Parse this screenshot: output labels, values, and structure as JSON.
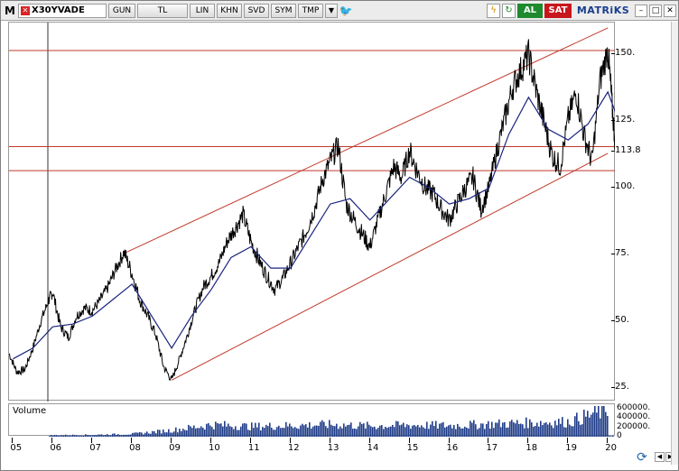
{
  "toolbar": {
    "menu_label": "M",
    "symbol": "X30YVADE",
    "buttons": [
      "GUN",
      "TL",
      "LIN",
      "KHN",
      "SVD",
      "SYM",
      "TMP"
    ],
    "buy_label": "AL",
    "sell_label": "SAT",
    "brand": "MATRiKS"
  },
  "price_axis": {
    "labels": [
      {
        "value": 150,
        "text": "150."
      },
      {
        "value": 125,
        "text": "125."
      },
      {
        "value": 113.8,
        "text": "113.8"
      },
      {
        "value": 100,
        "text": "100."
      },
      {
        "value": 75,
        "text": "75."
      },
      {
        "value": 50,
        "text": "50."
      },
      {
        "value": 25,
        "text": "25."
      }
    ]
  },
  "volume": {
    "title": "Volume",
    "labels": [
      {
        "value": 600000,
        "text": "600000."
      },
      {
        "value": 400000,
        "text": "400000."
      },
      {
        "value": 200000,
        "text": "200000."
      },
      {
        "value": 0,
        "text": "0"
      }
    ]
  },
  "date_axis": {
    "labels": [
      "05",
      "06",
      "07",
      "08",
      "09",
      "10",
      "11",
      "12",
      "13",
      "14",
      "15",
      "16",
      "17",
      "18",
      "19",
      "20"
    ]
  },
  "chart_data": {
    "type": "line",
    "ylim": [
      20,
      162
    ],
    "xlim": [
      2004.9,
      2020.2
    ],
    "horizontal_lines": [
      151.5,
      115.5,
      106.5
    ],
    "channel_upper": [
      [
        2007.8,
        75.5
      ],
      [
        2020.0,
        160.0
      ]
    ],
    "channel_lower": [
      [
        2009.0,
        28.0
      ],
      [
        2020.0,
        113.0
      ]
    ],
    "price_points": [
      [
        2004.9,
        38
      ],
      [
        2005.1,
        31
      ],
      [
        2005.3,
        32
      ],
      [
        2005.5,
        40
      ],
      [
        2005.7,
        50
      ],
      [
        2005.9,
        58
      ],
      [
        2006.0,
        61
      ],
      [
        2006.2,
        48
      ],
      [
        2006.4,
        44
      ],
      [
        2006.6,
        52
      ],
      [
        2006.8,
        55
      ],
      [
        2007.0,
        54
      ],
      [
        2007.2,
        58
      ],
      [
        2007.4,
        63
      ],
      [
        2007.6,
        70
      ],
      [
        2007.8,
        76
      ],
      [
        2008.0,
        68
      ],
      [
        2008.2,
        58
      ],
      [
        2008.4,
        52
      ],
      [
        2008.6,
        45
      ],
      [
        2008.8,
        33
      ],
      [
        2009.0,
        28
      ],
      [
        2009.2,
        36
      ],
      [
        2009.4,
        45
      ],
      [
        2009.6,
        55
      ],
      [
        2009.8,
        63
      ],
      [
        2010.0,
        67
      ],
      [
        2010.2,
        72
      ],
      [
        2010.4,
        80
      ],
      [
        2010.6,
        85
      ],
      [
        2010.8,
        90
      ],
      [
        2011.0,
        80
      ],
      [
        2011.2,
        73
      ],
      [
        2011.4,
        67
      ],
      [
        2011.6,
        62
      ],
      [
        2011.8,
        66
      ],
      [
        2012.0,
        72
      ],
      [
        2012.2,
        78
      ],
      [
        2012.4,
        84
      ],
      [
        2012.6,
        92
      ],
      [
        2012.8,
        103
      ],
      [
        2013.0,
        110
      ],
      [
        2013.2,
        116
      ],
      [
        2013.4,
        94
      ],
      [
        2013.6,
        88
      ],
      [
        2013.8,
        83
      ],
      [
        2014.0,
        78
      ],
      [
        2014.2,
        88
      ],
      [
        2014.4,
        98
      ],
      [
        2014.6,
        108
      ],
      [
        2014.8,
        104
      ],
      [
        2015.0,
        114
      ],
      [
        2015.2,
        106
      ],
      [
        2015.4,
        100
      ],
      [
        2015.6,
        98
      ],
      [
        2015.8,
        92
      ],
      [
        2016.0,
        88
      ],
      [
        2016.2,
        94
      ],
      [
        2016.4,
        100
      ],
      [
        2016.6,
        104
      ],
      [
        2016.8,
        92
      ],
      [
        2017.0,
        100
      ],
      [
        2017.2,
        114
      ],
      [
        2017.4,
        126
      ],
      [
        2017.6,
        138
      ],
      [
        2017.8,
        144
      ],
      [
        2018.0,
        150
      ],
      [
        2018.2,
        136
      ],
      [
        2018.4,
        124
      ],
      [
        2018.6,
        112
      ],
      [
        2018.8,
        108
      ],
      [
        2019.0,
        126
      ],
      [
        2019.2,
        136
      ],
      [
        2019.4,
        120
      ],
      [
        2019.6,
        110
      ],
      [
        2019.8,
        140
      ],
      [
        2020.0,
        152
      ],
      [
        2020.1,
        132
      ],
      [
        2020.2,
        113.8
      ]
    ],
    "ma_points": [
      [
        2005.0,
        36
      ],
      [
        2005.5,
        40
      ],
      [
        2006.0,
        48
      ],
      [
        2006.5,
        49
      ],
      [
        2007.0,
        52
      ],
      [
        2007.5,
        58
      ],
      [
        2008.0,
        64
      ],
      [
        2008.5,
        52
      ],
      [
        2009.0,
        40
      ],
      [
        2009.5,
        52
      ],
      [
        2010.0,
        62
      ],
      [
        2010.5,
        74
      ],
      [
        2011.0,
        78
      ],
      [
        2011.5,
        70
      ],
      [
        2012.0,
        70
      ],
      [
        2012.5,
        82
      ],
      [
        2013.0,
        94
      ],
      [
        2013.5,
        96
      ],
      [
        2014.0,
        88
      ],
      [
        2014.5,
        96
      ],
      [
        2015.0,
        104
      ],
      [
        2015.5,
        100
      ],
      [
        2016.0,
        94
      ],
      [
        2016.5,
        96
      ],
      [
        2017.0,
        100
      ],
      [
        2017.5,
        120
      ],
      [
        2018.0,
        134
      ],
      [
        2018.5,
        122
      ],
      [
        2019.0,
        118
      ],
      [
        2019.5,
        124
      ],
      [
        2020.0,
        136
      ],
      [
        2020.2,
        128
      ]
    ],
    "volume_scale": 700000,
    "volume_points": [
      [
        2005,
        20000
      ],
      [
        2006,
        30000
      ],
      [
        2007,
        40000
      ],
      [
        2008,
        60000
      ],
      [
        2009,
        140000
      ],
      [
        2010,
        260000
      ],
      [
        2011,
        220000
      ],
      [
        2012,
        240000
      ],
      [
        2013,
        260000
      ],
      [
        2014,
        230000
      ],
      [
        2015,
        250000
      ],
      [
        2016,
        240000
      ],
      [
        2017,
        270000
      ],
      [
        2018,
        300000
      ],
      [
        2019,
        320000
      ],
      [
        2020,
        600000
      ]
    ]
  }
}
